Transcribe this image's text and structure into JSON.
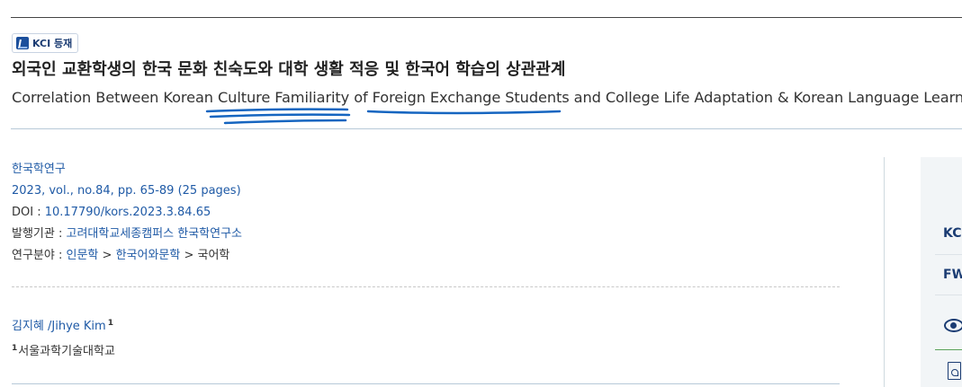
{
  "badge": {
    "label": "KCI 등재"
  },
  "title": {
    "korean": "외국인 교환학생의 한국 문화 친숙도와 대학 생활 적응 및 한국어 학습의 상관관계",
    "english": "Correlation Between Korean Culture Familiarity of Foreign Exchange Students and College Life Adaptation & Korean Language Learning"
  },
  "meta": {
    "journal": "한국학연구",
    "issue": "2023, vol., no.84, pp. 65-89 (25 pages)",
    "doi_label": "DOI : ",
    "doi": "10.17790/kors.2023.3.84.65",
    "publisher_label": "발행기관 : ",
    "publisher": "고려대학교세종캠퍼스 한국학연구소",
    "field_label": "연구분야 : ",
    "field_1": "인문학",
    "field_sep_1": " > ",
    "field_2": "한국어와문학",
    "field_sep_2": " > ",
    "field_3": "국어학"
  },
  "author": {
    "name": "김지혜 /Jihye Kim",
    "sup": "1"
  },
  "affiliation": {
    "sup": "1",
    "name": "서울과학기술대학교"
  },
  "sidebar": {
    "btn_kci": "KC",
    "btn_fw": "FW",
    "eye_icon": "eye-icon",
    "pdf_icon": "pdf-icon"
  },
  "colors": {
    "link": "#1f5aa6",
    "annotation": "#1565c0",
    "sidebar_bg": "#f2f5f7"
  }
}
